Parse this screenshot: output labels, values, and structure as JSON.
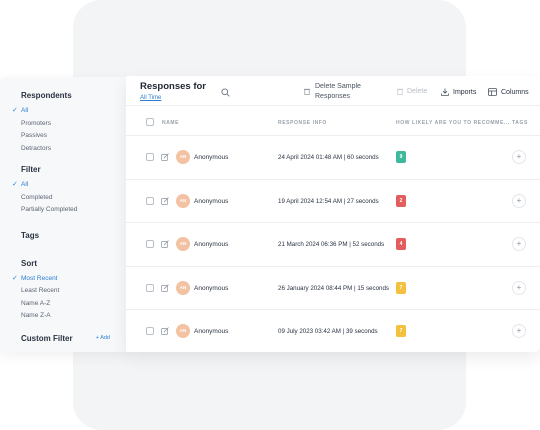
{
  "sidebar": {
    "respondents": {
      "title": "Respondents",
      "items": [
        {
          "label": "All",
          "active": true
        },
        {
          "label": "Promoters",
          "active": false
        },
        {
          "label": "Passives",
          "active": false
        },
        {
          "label": "Detractors",
          "active": false
        }
      ]
    },
    "filter": {
      "title": "Filter",
      "items": [
        {
          "label": "All",
          "active": true
        },
        {
          "label": "Completed",
          "active": false
        },
        {
          "label": "Partially Completed",
          "active": false
        }
      ]
    },
    "tags": {
      "title": "Tags"
    },
    "sort": {
      "title": "Sort",
      "items": [
        {
          "label": "Most Recent",
          "active": true
        },
        {
          "label": "Least Recent",
          "active": false
        },
        {
          "label": "Name A-Z",
          "active": false
        },
        {
          "label": "Name Z-A",
          "active": false
        }
      ]
    },
    "custom_filter": {
      "title": "Custom Filter",
      "add_label": "+ Add"
    },
    "check_glyph": "✓"
  },
  "header": {
    "title": "Responses for",
    "date_range": "All Time",
    "delete_sample_label": "Delete Sample Responses",
    "delete_label": "Delete",
    "imports_label": "Imports",
    "columns_label": "Columns"
  },
  "table": {
    "columns": [
      "NAME",
      "RESPONSE INFO",
      "HOW LIKELY ARE YOU TO RECOMME...",
      "TAGS"
    ],
    "rows": [
      {
        "initials": "AN",
        "name": "Anonymous",
        "info": "24 April 2024 01:48 AM | 60 seconds",
        "score": "9",
        "score_color": "#3fb89b"
      },
      {
        "initials": "AN",
        "name": "Anonymous",
        "info": "19 April 2024 12:54 AM | 27 seconds",
        "score": "2",
        "score_color": "#e35d5d"
      },
      {
        "initials": "AN",
        "name": "Anonymous",
        "info": "21 March 2024 06:36 PM | 52 seconds",
        "score": "4",
        "score_color": "#e35d5d"
      },
      {
        "initials": "AN",
        "name": "Anonymous",
        "info": "26 January 2024 08:44 PM | 15 seconds",
        "score": "7",
        "score_color": "#f4c13e"
      },
      {
        "initials": "AN",
        "name": "Anonymous",
        "info": "09 July 2023 03:42 AM | 39 seconds",
        "score": "7",
        "score_color": "#f4c13e"
      }
    ],
    "tag_add_glyph": "+"
  },
  "colors": {
    "accent": "#2d7fd0",
    "avatar": "#f2c2a3"
  }
}
